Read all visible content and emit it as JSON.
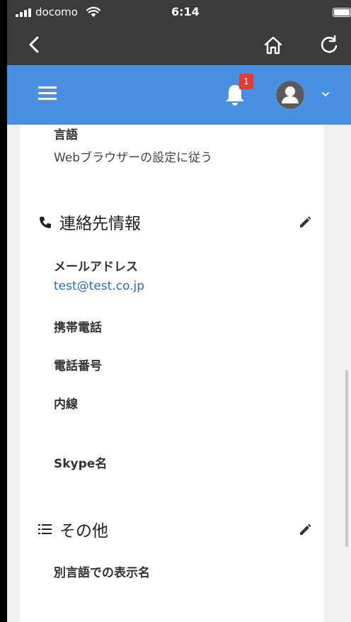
{
  "statusbar": {
    "carrier": "docomo",
    "time": "6:14"
  },
  "notifications": {
    "count": "1"
  },
  "profile": {
    "language": {
      "label": "言語",
      "value": "Webブラウザーの設定に従う"
    },
    "contact": {
      "title": "連絡先情報",
      "email_label": "メールアドレス",
      "email_value": "test@test.co.jp",
      "mobile_label": "携帯電話",
      "phone_label": "電話番号",
      "extension_label": "内線",
      "skype_label": "Skype名"
    },
    "other": {
      "title": "その他",
      "alt_name_label": "別言語での表示名"
    }
  },
  "icons": {
    "back": "back-icon",
    "home": "home-icon",
    "reload": "reload-icon",
    "menu": "menu-icon",
    "bell": "bell-icon",
    "avatar": "avatar-icon",
    "phone": "phone-icon",
    "list": "list-icon",
    "edit": "pencil-icon"
  },
  "colors": {
    "appbar": "#4a90e2",
    "browserbar": "#3b3b3b",
    "badge": "#e53935",
    "link": "#2f6bbf"
  }
}
